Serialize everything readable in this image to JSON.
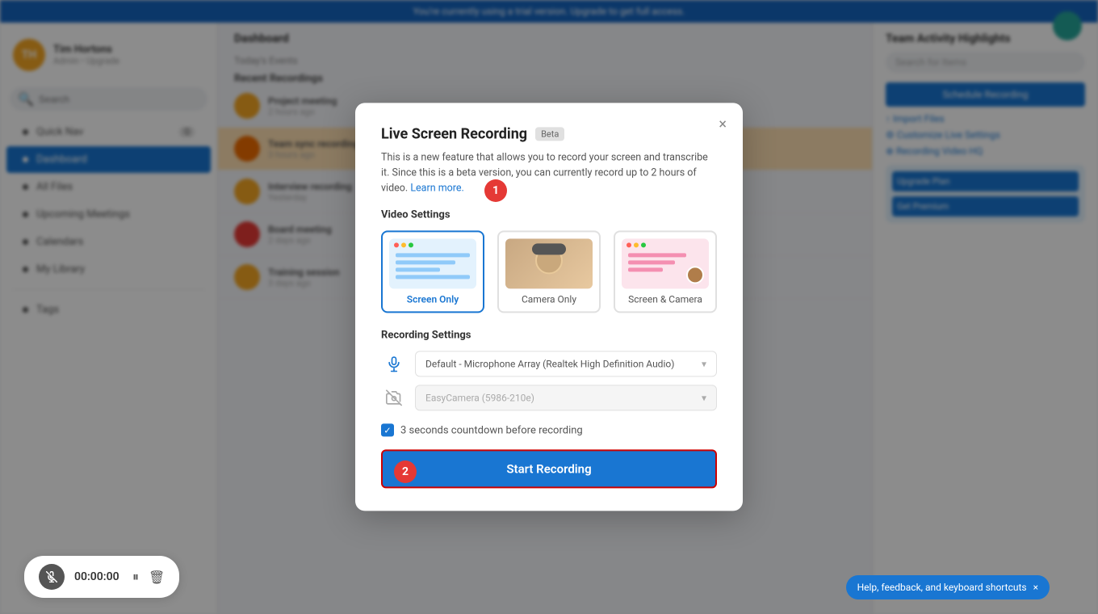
{
  "topbar": {
    "message": "You're currently using a trial version. Upgrade to get full access."
  },
  "sidebar": {
    "user": {
      "initials": "TH",
      "name": "Tim Hortons",
      "sub": "Admin • Upgrade"
    },
    "search": {
      "placeholder": "Search"
    },
    "items": [
      {
        "id": "quick-nav",
        "label": "Quick Nav",
        "badge": "Q"
      },
      {
        "id": "dashboard",
        "label": "Dashboard",
        "active": true
      },
      {
        "id": "all-files",
        "label": "All Files",
        "badge": ""
      },
      {
        "id": "upcoming-meetings",
        "label": "Upcoming Meetings"
      },
      {
        "id": "calendars",
        "label": "Calendars"
      },
      {
        "id": "my-library",
        "label": "My Library"
      },
      {
        "id": "tags",
        "label": "Tags"
      }
    ]
  },
  "main": {
    "title": "Dashboard",
    "subtitle": "Today's Events",
    "recent_section": "Recent Recordings"
  },
  "modal": {
    "title": "Live Screen Recording",
    "beta_label": "Beta",
    "description": "This is a new feature that allows you to record your screen and transcribe it. Since this is a beta version, you can currently record up to 2 hours of video.",
    "learn_more": "Learn more.",
    "video_settings_label": "Video Settings",
    "video_options": [
      {
        "id": "screen-only",
        "label": "Screen Only",
        "selected": true
      },
      {
        "id": "camera-only",
        "label": "Camera Only",
        "selected": false
      },
      {
        "id": "screen-camera",
        "label": "Screen & Camera",
        "selected": false
      }
    ],
    "recording_settings_label": "Recording Settings",
    "microphone_default": "Default - Microphone Array (Realtek High Definition Audio)",
    "camera_default": "EasyCamera (5986-210e)",
    "checkbox_label": "3 seconds countdown before recording",
    "checkbox_checked": true,
    "start_button": "Start Recording",
    "close_icon": "×"
  },
  "steps": {
    "step1_number": "1",
    "step2_number": "2"
  },
  "bottom_bar": {
    "timer": "00:00:00"
  },
  "help_bar": {
    "text": "Help, feedback, and keyboard shortcuts",
    "close": "×"
  }
}
